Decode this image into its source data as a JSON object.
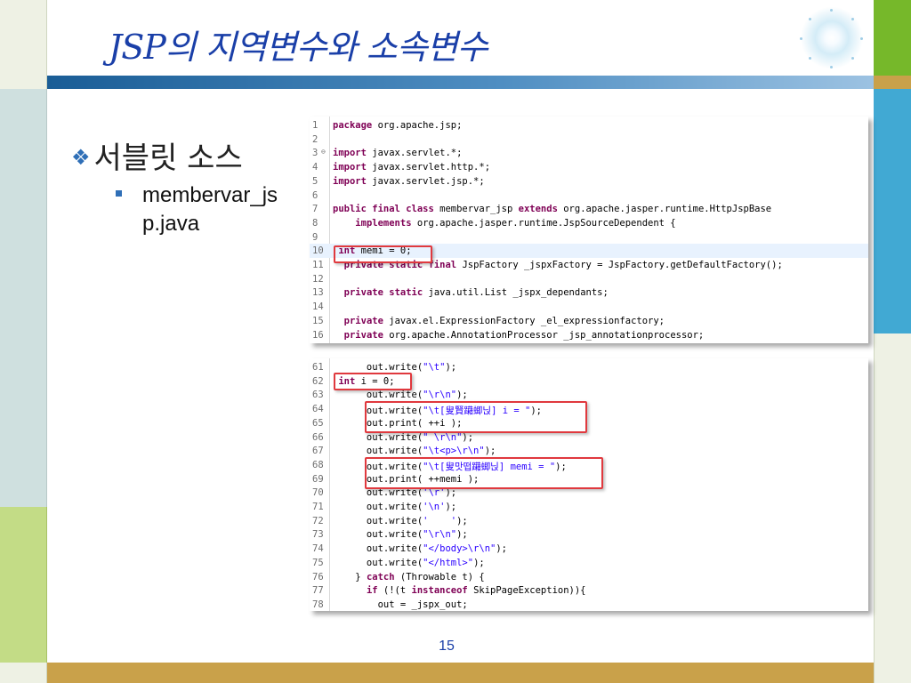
{
  "title": "JSP의 지역변수와 소속변수",
  "bullets": {
    "level1": "서블릿 소스",
    "level2": "membervar_jsp.java"
  },
  "page_number": "15",
  "code_panel_1": [
    {
      "n": "1",
      "src": "package org.apache.jsp;"
    },
    {
      "n": "2",
      "src": ""
    },
    {
      "n": "3",
      "src": "import javax.servlet.*;"
    },
    {
      "n": "4",
      "src": "import javax.servlet.http.*;"
    },
    {
      "n": "5",
      "src": "import javax.servlet.jsp.*;"
    },
    {
      "n": "6",
      "src": ""
    },
    {
      "n": "7",
      "src": "public final class membervar_jsp extends org.apache.jasper.runtime.HttpJspBase"
    },
    {
      "n": "8",
      "src": "    implements org.apache.jasper.runtime.JspSourceDependent {"
    },
    {
      "n": "9",
      "src": ""
    },
    {
      "n": "10",
      "src": " int memi = 0;"
    },
    {
      "n": "11",
      "src": "  private static final JspFactory _jspxFactory = JspFactory.getDefaultFactory();"
    },
    {
      "n": "12",
      "src": ""
    },
    {
      "n": "13",
      "src": "  private static java.util.List _jspx_dependants;"
    },
    {
      "n": "14",
      "src": ""
    },
    {
      "n": "15",
      "src": "  private javax.el.ExpressionFactory _el_expressionfactory;"
    },
    {
      "n": "16",
      "src": "  private org.apache.AnnotationProcessor _jsp_annotationprocessor;"
    }
  ],
  "code_panel_2": [
    {
      "n": "61",
      "src": "      out.write(\"\\t\");"
    },
    {
      "n": "62",
      "src": " int i = 0;"
    },
    {
      "n": "63",
      "src": "      out.write(\"\\r\\n\");"
    },
    {
      "n": "64",
      "src": "      out.write(\"\\t[叟賢躤蝍닍] i = \");"
    },
    {
      "n": "65",
      "src": "      out.print( ++i );"
    },
    {
      "n": "66",
      "src": "      out.write(\" \\r\\n\");"
    },
    {
      "n": "67",
      "src": "      out.write(\"\\t<p>\\r\\n\");"
    },
    {
      "n": "68",
      "src": "      out.write(\"\\t[叟맛떱躤蝍닍] memi = \");"
    },
    {
      "n": "69",
      "src": "      out.print( ++memi );"
    },
    {
      "n": "70",
      "src": "      out.write('\\r');"
    },
    {
      "n": "71",
      "src": "      out.write('\\n');"
    },
    {
      "n": "72",
      "src": "      out.write('    ');"
    },
    {
      "n": "73",
      "src": "      out.write(\"\\r\\n\");"
    },
    {
      "n": "74",
      "src": "      out.write(\"</body>\\r\\n\");"
    },
    {
      "n": "75",
      "src": "      out.write(\"</html>\");"
    },
    {
      "n": "76",
      "src": "    } catch (Throwable t) {"
    },
    {
      "n": "77",
      "src": "      if (!(t instanceof SkipPageException)){"
    },
    {
      "n": "78",
      "src": "        out = _jspx_out;"
    }
  ]
}
